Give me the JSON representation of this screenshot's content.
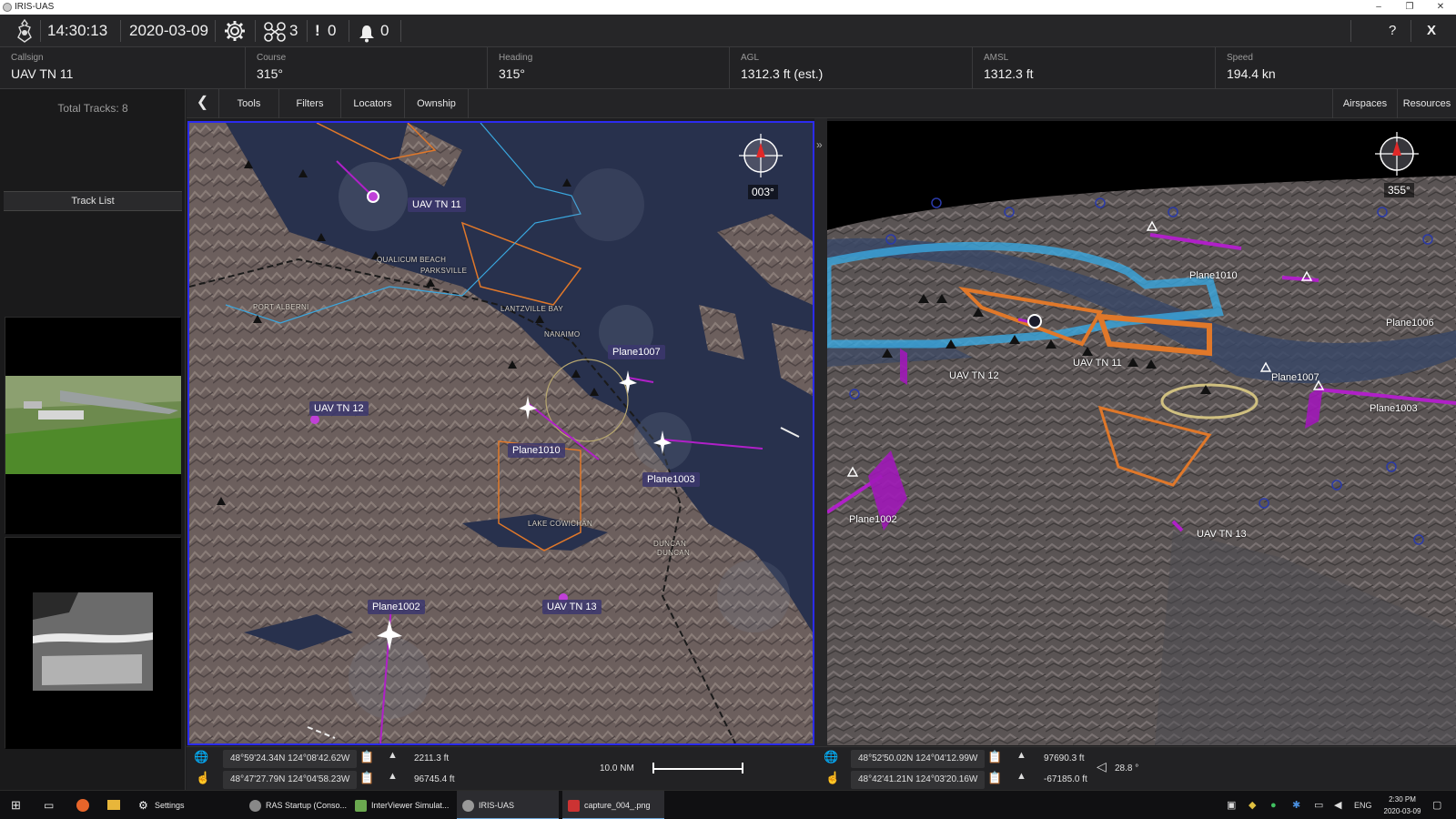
{
  "window": {
    "title": "IRIS-UAS",
    "minimize": "–",
    "restore": "❐",
    "close": "✕"
  },
  "toolbar": {
    "time": "14:30:13",
    "date": "2020-03-09",
    "drone_count": "3",
    "alert_count": "0",
    "notification_count": "0",
    "help": "?",
    "exit": "X"
  },
  "info": {
    "callsign": {
      "label": "Callsign",
      "value": "UAV TN 11"
    },
    "course": {
      "label": "Course",
      "value": "315°"
    },
    "heading": {
      "label": "Heading",
      "value": "315°"
    },
    "agl": {
      "label": "AGL",
      "value": "1312.3 ft (est.)"
    },
    "amsl": {
      "label": "AMSL",
      "value": "1312.3 ft"
    },
    "speed": {
      "label": "Speed",
      "value": "194.4 kn"
    }
  },
  "sidebar": {
    "total_tracks": "Total Tracks: 8",
    "track_list": "Track List"
  },
  "tabs": {
    "tools": "Tools",
    "filters": "Filters",
    "locators": "Locators",
    "ownship": "Ownship",
    "airspaces": "Airspaces",
    "resources": "Resources"
  },
  "map2d": {
    "compass_heading": "003°",
    "places": {
      "qualicum": "QUALICUM BEACH",
      "parksville": "PARKSVILLE",
      "port_alberni": "PORT ALBERNI",
      "lantzville": "LANTZVILLE BAY",
      "nanaimo": "NANAIMO",
      "lake_cowichan": "LAKE COWICHAN",
      "duncan1": "DUNCAN",
      "duncan2": "DUNCAN"
    },
    "tracks": {
      "uav11": "UAV TN 11",
      "uav12": "UAV TN 12",
      "uav13": "UAV TN 13",
      "plane1007": "Plane1007",
      "plane1010": "Plane1010",
      "plane1003": "Plane1003",
      "plane1002": "Plane1002"
    }
  },
  "map3d": {
    "compass_heading": "355°",
    "tracks": {
      "plane1010": "Plane1010",
      "plane1006": "Plane1006",
      "uav12": "UAV TN 12",
      "uav11": "UAV TN 11",
      "plane1007": "Plane1007",
      "plane1003": "Plane1003",
      "plane1002": "Plane1002",
      "uav13": "UAV TN 13"
    }
  },
  "coords": {
    "left": {
      "cursor_pos": "48°59'24.34N 124°08'42.62W",
      "cursor_alt": "2211.3 ft",
      "touch_pos": "48°47'27.79N 124°04'58.23W",
      "touch_alt": "96745.4 ft"
    },
    "scale": "10.0 NM",
    "right": {
      "cursor_pos": "48°52'50.02N 124°04'12.99W",
      "cursor_alt": "97690.3 ft",
      "touch_pos": "48°42'41.21N 124°03'20.16W",
      "touch_alt": "-67185.0 ft",
      "tilt": "28.8 °"
    }
  },
  "taskbar": {
    "settings": "Settings",
    "ras": "RAS Startup (Conso...",
    "interviewer": "InterViewer Simulat...",
    "iris": "IRIS-UAS",
    "capture": "capture_004_.png",
    "lang": "ENG",
    "time": "2:30 PM",
    "date": "2020-03-09"
  },
  "colors": {
    "accent_blue": "#2b2bf0",
    "track_magenta": "#b020c8",
    "airspace_orange": "#e0782a",
    "airspace_cyan": "#3aa8e0"
  }
}
